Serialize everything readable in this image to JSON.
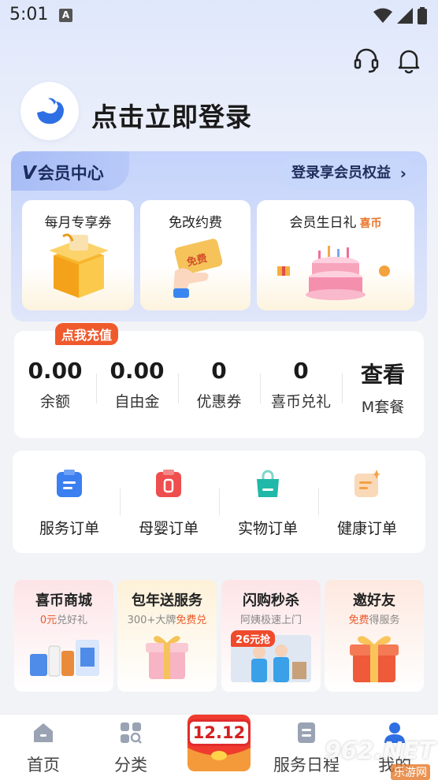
{
  "status_bar": {
    "time": "5:01",
    "notif_letter": "A"
  },
  "header": {
    "icons": [
      "headset-icon",
      "bell-icon"
    ],
    "login_text": "点击立即登录"
  },
  "vip": {
    "title_v": "V",
    "title": "会员中心",
    "cta": "登录享会员权益",
    "cta_chevron": "›",
    "benefits": [
      {
        "label": "每月专享券",
        "tag": ""
      },
      {
        "label": "免改约费",
        "tag": "",
        "badge": "免费"
      },
      {
        "label": "会员生日礼",
        "tag": "喜币"
      }
    ]
  },
  "wallet": {
    "badge": "点我充值",
    "items": [
      {
        "value": "0.00",
        "label": "余额"
      },
      {
        "value": "0.00",
        "label": "自由金"
      },
      {
        "value": "0",
        "label": "优惠券"
      },
      {
        "value": "0",
        "label": "喜币兑礼"
      },
      {
        "value": "查看",
        "label": "M套餐"
      }
    ]
  },
  "orders": {
    "items": [
      {
        "label": "服务订单",
        "icon": "service-order-icon",
        "color": "#3b7ff0"
      },
      {
        "label": "母婴订单",
        "icon": "baby-order-icon",
        "color": "#ee4e4e"
      },
      {
        "label": "实物订单",
        "icon": "goods-order-icon",
        "color": "#20b8a8"
      },
      {
        "label": "健康订单",
        "icon": "health-order-icon",
        "color": "#f5a046"
      }
    ]
  },
  "promos": [
    {
      "title": "喜币商城",
      "sub_pre": "",
      "sub_hl": "0元",
      "sub_post": "兑好礼"
    },
    {
      "title": "包年送服务",
      "sub_pre": "300+大牌",
      "sub_hl": "免费兑",
      "sub_post": ""
    },
    {
      "title": "闪购秒杀",
      "sub_pre": "阿姨极速上门",
      "sub_hl": "",
      "sub_post": "",
      "tag": "26元抢"
    },
    {
      "title": "邀好友",
      "sub_pre": "",
      "sub_hl": "免费",
      "sub_post": "得服务"
    }
  ],
  "tabbar": {
    "items": [
      {
        "label": "首页",
        "icon": "home-icon"
      },
      {
        "label": "分类",
        "icon": "category-icon"
      },
      {
        "label": "服务日程",
        "icon": "schedule-icon"
      },
      {
        "label": "我的",
        "icon": "profile-icon"
      }
    ],
    "promo_text": "12.12"
  },
  "watermark": {
    "main": "962.NET",
    "sub": "乐游网"
  },
  "colors": {
    "accent": "#3b7ff0",
    "orange": "#e85a2c",
    "vip_bg": "#c4d3fb"
  }
}
